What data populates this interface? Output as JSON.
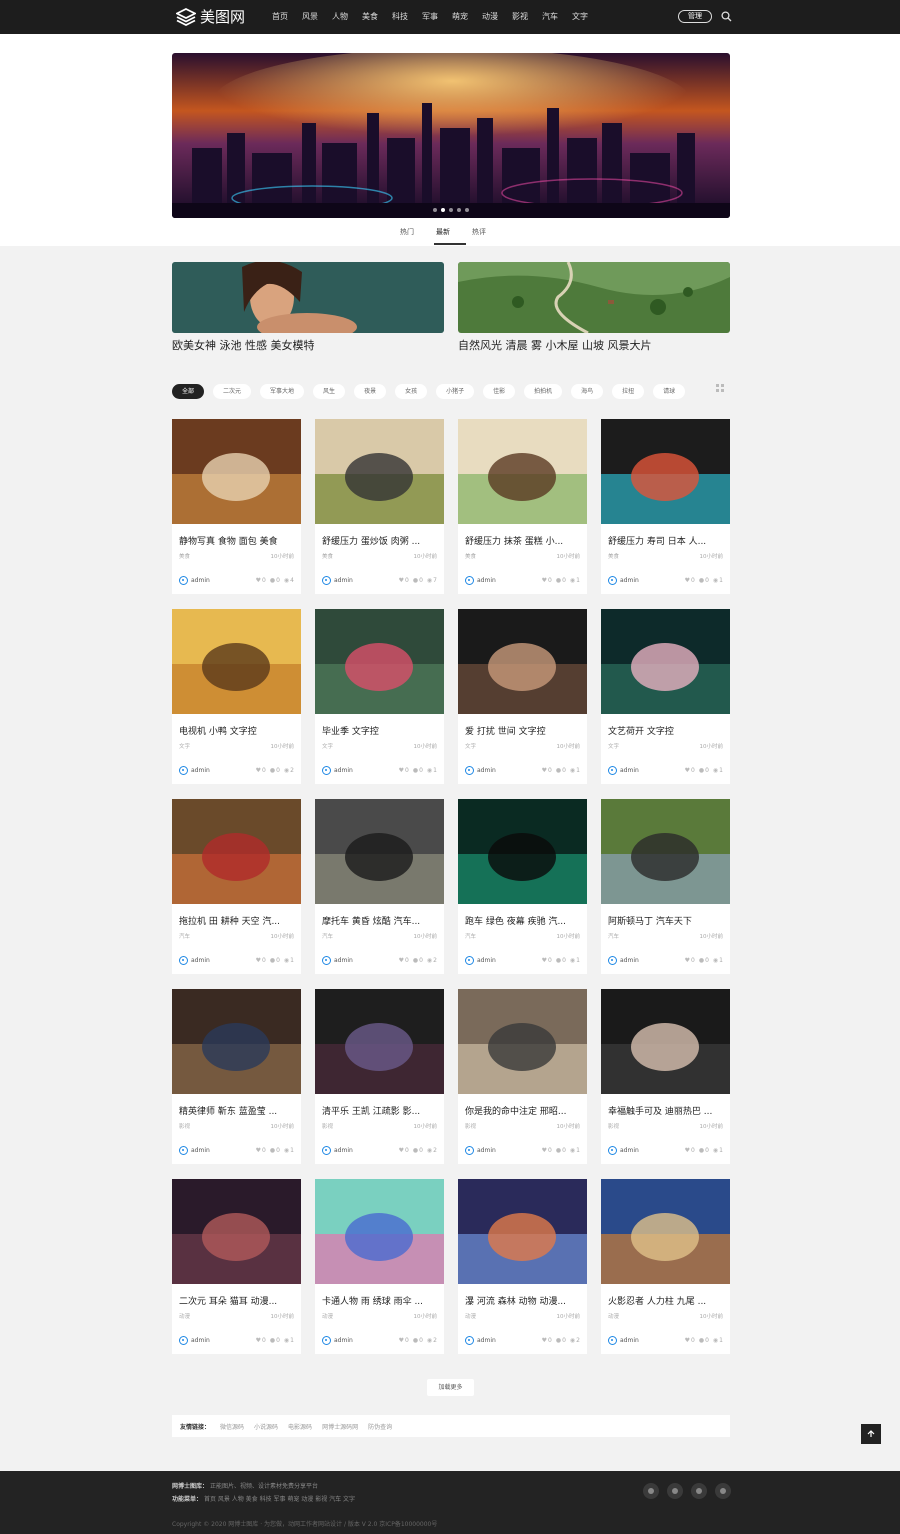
{
  "header": {
    "logo_text": "美图网",
    "nav": [
      "首页",
      "风景",
      "人物",
      "美食",
      "科技",
      "军事",
      "萌宠",
      "动漫",
      "影视",
      "汽车",
      "文字"
    ],
    "manage_label": "管理"
  },
  "banner": {
    "slide_count": 5,
    "active_slide": 2
  },
  "tabs": {
    "items": [
      "热门",
      "最新",
      "热评"
    ],
    "active_index": 1
  },
  "featured": [
    {
      "title": "欧美女神 泳池 性感 美女模特"
    },
    {
      "title": "自然风光 清晨 雾 小木屋 山坡 风景大片"
    }
  ],
  "categories": {
    "items": [
      "全部",
      "二次元",
      "军事大地",
      "风生",
      "夜景",
      "女孩",
      "小猪子",
      "佳影",
      "拍拍机",
      "海鸟",
      "拉扭",
      "请球"
    ],
    "active_index": 0
  },
  "posts": [
    {
      "title": "静物写真 食物 面包 美食",
      "category": "美食",
      "time": "10小时前",
      "author": "admin",
      "likes": "0",
      "comments": "0",
      "views": "4"
    },
    {
      "title": "舒缓压力 蛋炒饭 肉粥 ...",
      "category": "美食",
      "time": "10小时前",
      "author": "admin",
      "likes": "0",
      "comments": "0",
      "views": "7"
    },
    {
      "title": "舒缓压力 抹茶 蛋糕 小...",
      "category": "美食",
      "time": "10小时前",
      "author": "admin",
      "likes": "0",
      "comments": "0",
      "views": "1"
    },
    {
      "title": "舒缓压力 寿司 日本 人...",
      "category": "美食",
      "time": "10小时前",
      "author": "admin",
      "likes": "0",
      "comments": "0",
      "views": "1"
    },
    {
      "title": "电视机 小鸭 文字控",
      "category": "文字",
      "time": "10小时前",
      "author": "admin",
      "likes": "0",
      "comments": "0",
      "views": "2"
    },
    {
      "title": "毕业季 文字控",
      "category": "文字",
      "time": "10小时前",
      "author": "admin",
      "likes": "0",
      "comments": "0",
      "views": "1"
    },
    {
      "title": "爱 打扰 世间 文字控",
      "category": "文字",
      "time": "10小时前",
      "author": "admin",
      "likes": "0",
      "comments": "0",
      "views": "1"
    },
    {
      "title": "文艺荷开 文字控",
      "category": "文字",
      "time": "10小时前",
      "author": "admin",
      "likes": "0",
      "comments": "0",
      "views": "1"
    },
    {
      "title": "拖拉机 田 耕种 天空 汽...",
      "category": "汽车",
      "time": "10小时前",
      "author": "admin",
      "likes": "0",
      "comments": "0",
      "views": "1"
    },
    {
      "title": "摩托车 黄昏 炫酷 汽车...",
      "category": "汽车",
      "time": "10小时前",
      "author": "admin",
      "likes": "0",
      "comments": "0",
      "views": "2"
    },
    {
      "title": "跑车 绿色 夜幕 疾驰 汽...",
      "category": "汽车",
      "time": "10小时前",
      "author": "admin",
      "likes": "0",
      "comments": "0",
      "views": "1"
    },
    {
      "title": "阿斯顿马丁 汽车天下",
      "category": "汽车",
      "time": "10小时前",
      "author": "admin",
      "likes": "0",
      "comments": "0",
      "views": "1"
    },
    {
      "title": "精英律师 靳东 蓝盈莹 ...",
      "category": "影视",
      "time": "10小时前",
      "author": "admin",
      "likes": "0",
      "comments": "0",
      "views": "1"
    },
    {
      "title": "清平乐 王凯 江疏影 影...",
      "category": "影视",
      "time": "10小时前",
      "author": "admin",
      "likes": "0",
      "comments": "0",
      "views": "2"
    },
    {
      "title": "你是我的命中注定 邢昭...",
      "category": "影视",
      "time": "10小时前",
      "author": "admin",
      "likes": "0",
      "comments": "0",
      "views": "1"
    },
    {
      "title": "幸福触手可及 迪丽热巴 ...",
      "category": "影视",
      "time": "10小时前",
      "author": "admin",
      "likes": "0",
      "comments": "0",
      "views": "1"
    },
    {
      "title": "二次元 耳朵 猫耳 动漫...",
      "category": "动漫",
      "time": "10小时前",
      "author": "admin",
      "likes": "0",
      "comments": "0",
      "views": "1"
    },
    {
      "title": "卡通人物 雨 绣球 雨伞 ...",
      "category": "动漫",
      "time": "10小时前",
      "author": "admin",
      "likes": "0",
      "comments": "0",
      "views": "2"
    },
    {
      "title": "瀑 河流 森林 动物 动漫...",
      "category": "动漫",
      "time": "10小时前",
      "author": "admin",
      "likes": "0",
      "comments": "0",
      "views": "2"
    },
    {
      "title": "火影忍者 人力柱 九尾 ...",
      "category": "动漫",
      "time": "10小时前",
      "author": "admin",
      "likes": "0",
      "comments": "0",
      "views": "1"
    }
  ],
  "load_more_label": "加载更多",
  "friend_links": {
    "label": "友情链接：",
    "items": [
      "微信源码",
      "小说源码",
      "电影源码",
      "网博士源码网",
      "防伪查询"
    ]
  },
  "footer": {
    "line1_label": "网博士图库：",
    "line1_text": "正能图片、视频、设计素材免费分享平台",
    "line2_label": "功能菜单：",
    "line2_items": "首页  风景  人物  美食  科技  军事  萌宠  动漫  影视  汽车  文字",
    "copyright": "Copyright © 2020 网博士图库 · 为您做，动网工作者网站设计 / 版本 V 2.0 京ICP备10000000号"
  }
}
